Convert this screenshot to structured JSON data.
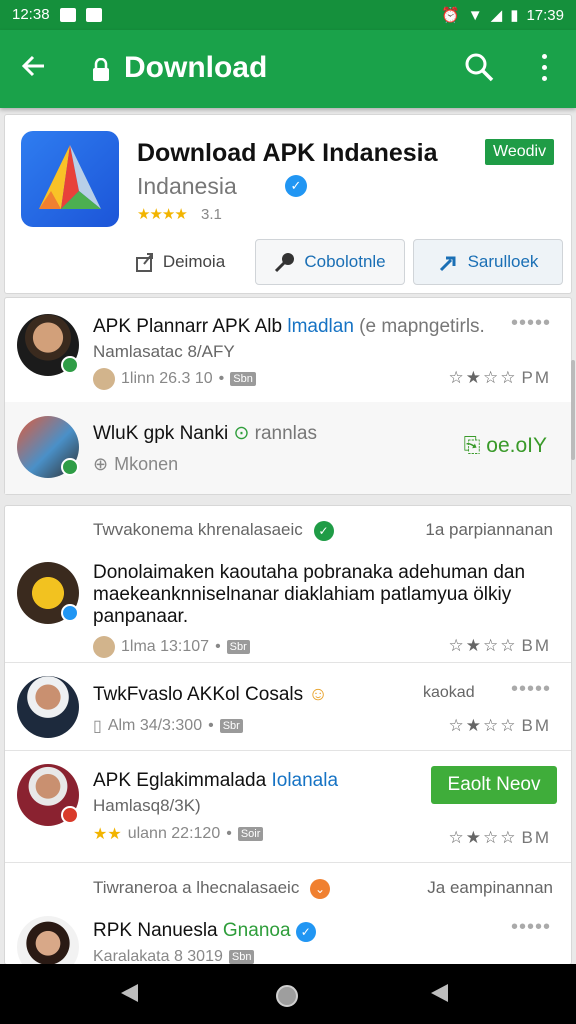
{
  "status_bar": {
    "left_time": "12:38",
    "right_time": "17:39"
  },
  "app_bar": {
    "title": "Download",
    "back_icon": "back-arrow-icon",
    "lock_icon": "lock-icon",
    "search_icon": "search-icon",
    "more_icon": "more-vert-icon"
  },
  "app_card": {
    "title": "Download APK Indanesia",
    "subtitle": "Indanesia",
    "rating": "3.1",
    "badge": "Weodiv",
    "buttons": [
      {
        "label": "Deimoia",
        "icon": "share-icon"
      },
      {
        "label": "Cobolotnle",
        "icon": "key-icon"
      },
      {
        "label": "Sarulloek",
        "icon": "arrow-icon"
      }
    ]
  },
  "list1": [
    {
      "name": "APK Plannarr APK Alb",
      "name_hl": "lmadlan",
      "name_mu": "(e mapngetirls.",
      "sub": "Namlasatac 8/AFY",
      "meta": "1linn 26.3 10",
      "pill": "Sbn",
      "rating_text": "PM"
    },
    {
      "name": "WluK gpk Nanki",
      "name_mu": "rannlas",
      "meta": "Mkonen",
      "action": "oe.oIY"
    }
  ],
  "group1": {
    "left": "Twvakonema khrenalasaeic",
    "right": "1a parpiannanan"
  },
  "list2": [
    {
      "para": "Donolaimaken kaoutaha pobranaka adehuman dan maekeanknniselnanar diaklahiam patlamyua ölkiy panpanaar.",
      "meta": "1lma 13:107",
      "pill": "Sbr",
      "rating_text": "BM"
    },
    {
      "name": "TwkFvaslo AKKol Cosals",
      "name_mu": "kaokad",
      "meta": "Alm 34/3:300",
      "pill": "Sbr",
      "rating_text": "BM"
    },
    {
      "name": "APK Eglakimmalada",
      "name_hl": "Iolanala",
      "sub": "Hamlasq8/3K)",
      "meta": "ulann 22:120",
      "pill": "Soir",
      "rating_text": "BM",
      "button": "Eaolt Neov"
    }
  ],
  "group2": {
    "left": "Tiwraneroa a lhecnalasaeic",
    "right": "Ja eampinannan"
  },
  "list3": [
    {
      "name": "RPK Nanuesla",
      "name_hlg": "Gnanoa",
      "sub": "Karalakata 8 3019",
      "pill": "Sbn"
    }
  ],
  "colors": {
    "status": "#15903c",
    "appbar": "#1aa24a",
    "accent_blue": "#1673c4",
    "accent_green": "#3fad3a"
  }
}
